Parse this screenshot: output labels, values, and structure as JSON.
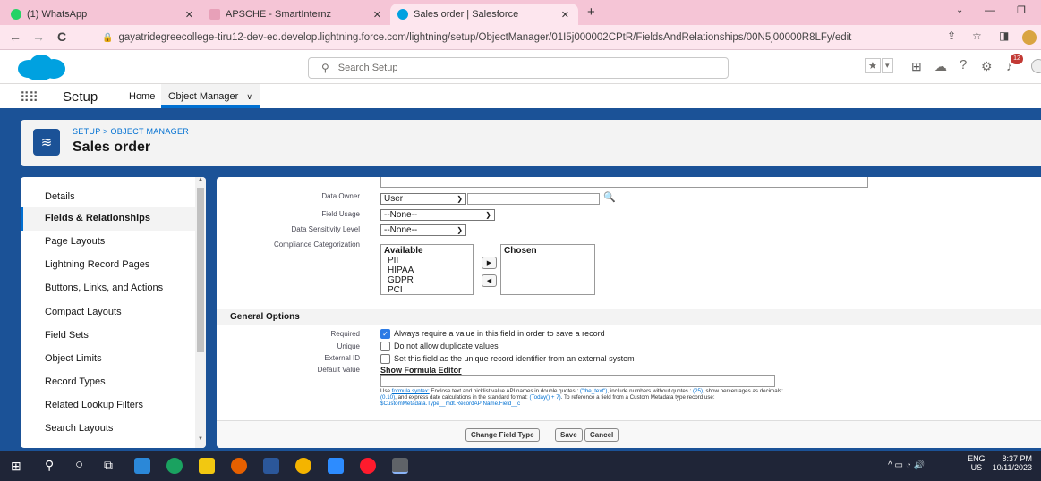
{
  "browser": {
    "tabs": [
      {
        "label": "(1) WhatsApp"
      },
      {
        "label": "APSCHE - SmartInternz"
      },
      {
        "label": "Sales order | Salesforce"
      }
    ],
    "url": "gayatridegreecollege-tiru12-dev-ed.develop.lightning.force.com/lightning/setup/ObjectManager/01I5j000002CPtR/FieldsAndRelationships/00N5j00000R8LFy/edit",
    "new_tab": "+"
  },
  "header": {
    "search_placeholder": "Search Setup",
    "notification_count": "12"
  },
  "appnav": {
    "app_name": "Setup",
    "home": "Home",
    "object_manager": "Object Manager"
  },
  "page": {
    "breadcrumb": "SETUP > OBJECT MANAGER",
    "title": "Sales order"
  },
  "sidebar": {
    "items": [
      {
        "label": "Details"
      },
      {
        "label": "Fields & Relationships"
      },
      {
        "label": "Page Layouts"
      },
      {
        "label": "Lightning Record Pages"
      },
      {
        "label": "Buttons, Links, and Actions"
      },
      {
        "label": "Compact Layouts"
      },
      {
        "label": "Field Sets"
      },
      {
        "label": "Object Limits"
      },
      {
        "label": "Record Types"
      },
      {
        "label": "Related Lookup Filters"
      },
      {
        "label": "Search Layouts"
      }
    ],
    "selected": "Fields & Relationships"
  },
  "form": {
    "data_owner_label": "Data Owner",
    "data_owner_value": "User",
    "field_usage_label": "Field Usage",
    "field_usage_value": "--None--",
    "sensitivity_label": "Data Sensitivity Level",
    "sensitivity_value": "--None--",
    "compliance_label": "Compliance Categorization",
    "available_header": "Available",
    "available_items": [
      "PII",
      "HIPAA",
      "GDPR",
      "PCI"
    ],
    "chosen_header": "Chosen",
    "general_options": "General Options",
    "required_label": "Required",
    "required_text": "Always require a value in this field in order to save a record",
    "unique_label": "Unique",
    "unique_text": "Do not allow duplicate values",
    "external_label": "External ID",
    "external_text": "Set this field as the unique record identifier from an external system",
    "default_label": "Default Value",
    "formula_link": "Show Formula Editor",
    "help_use": "Use ",
    "help_link1": "formula syntax:",
    "help_p1": " Enclose text and picklist value API names in double quotes : ",
    "help_ex1": "(\"the_text\")",
    "help_p2": ", include numbers without quotes : ",
    "help_ex2": "(25)",
    "help_p3": ", show percentages as decimals: ",
    "help_ex3": "(0.10)",
    "help_p4": ", and express date calculations in the standard format: ",
    "help_ex4": "(Today() + 7)",
    "help_p5": ". To reference a field from a Custom Metadata type record use: ",
    "help_ex5": "$CustomMetadata.Type__mdt.RecordAPIName.Field__c"
  },
  "buttons": {
    "change_type": "Change Field Type",
    "save": "Save",
    "cancel": "Cancel"
  },
  "tray": {
    "lang": "ENG",
    "region": "US",
    "time": "8:37 PM",
    "date": "10/11/2023"
  },
  "colors": {
    "brand": "#1b5297",
    "link": "#0070d2",
    "tabbar": "#f5c5d6"
  }
}
